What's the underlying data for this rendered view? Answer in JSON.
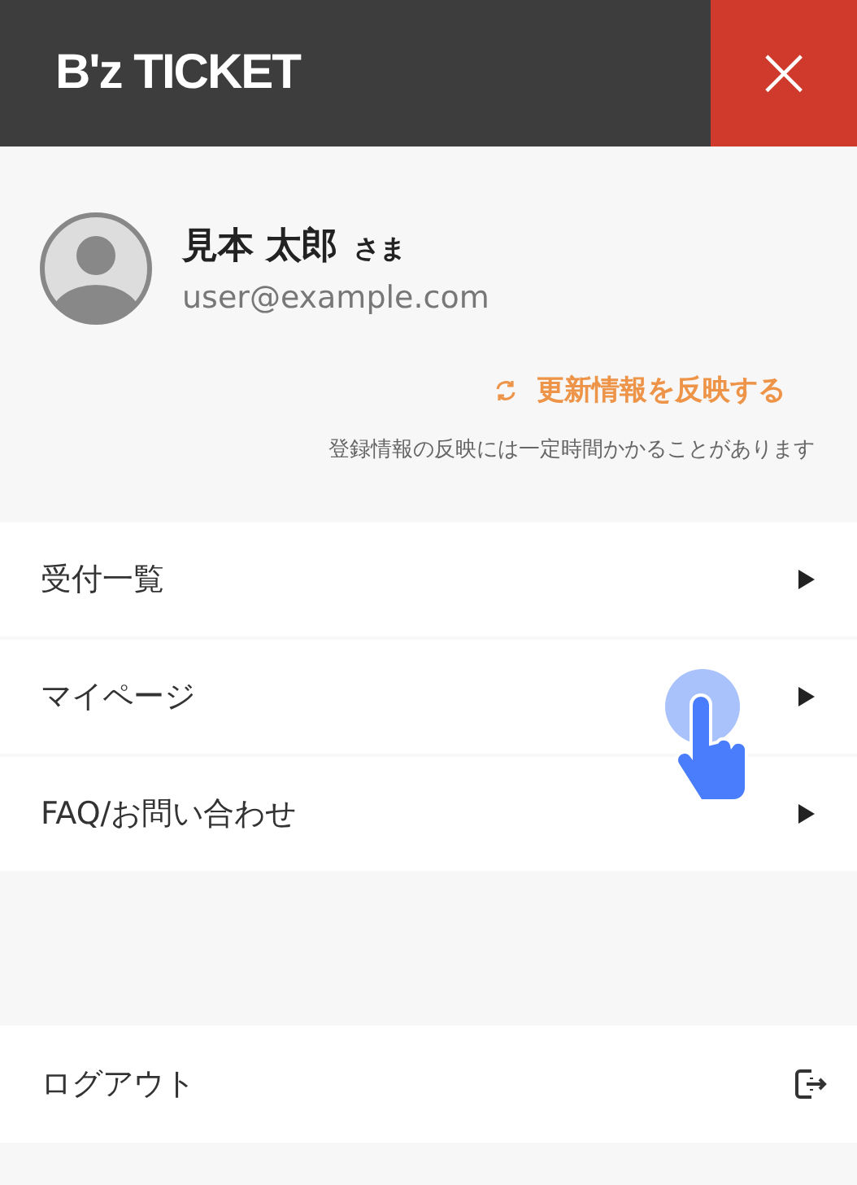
{
  "header": {
    "logo": "B'z TICKET",
    "close": "×"
  },
  "user": {
    "name": "見本 太郎",
    "honorific": "さま",
    "email": "user@example.com"
  },
  "refresh": {
    "label": "更新情報を反映する",
    "note": "登録情報の反映には一定時間かかることがあります"
  },
  "menu": [
    {
      "label": "受付一覧"
    },
    {
      "label": "マイページ"
    },
    {
      "label": "FAQ/お問い合わせ"
    }
  ],
  "logout": {
    "label": "ログアウト"
  }
}
